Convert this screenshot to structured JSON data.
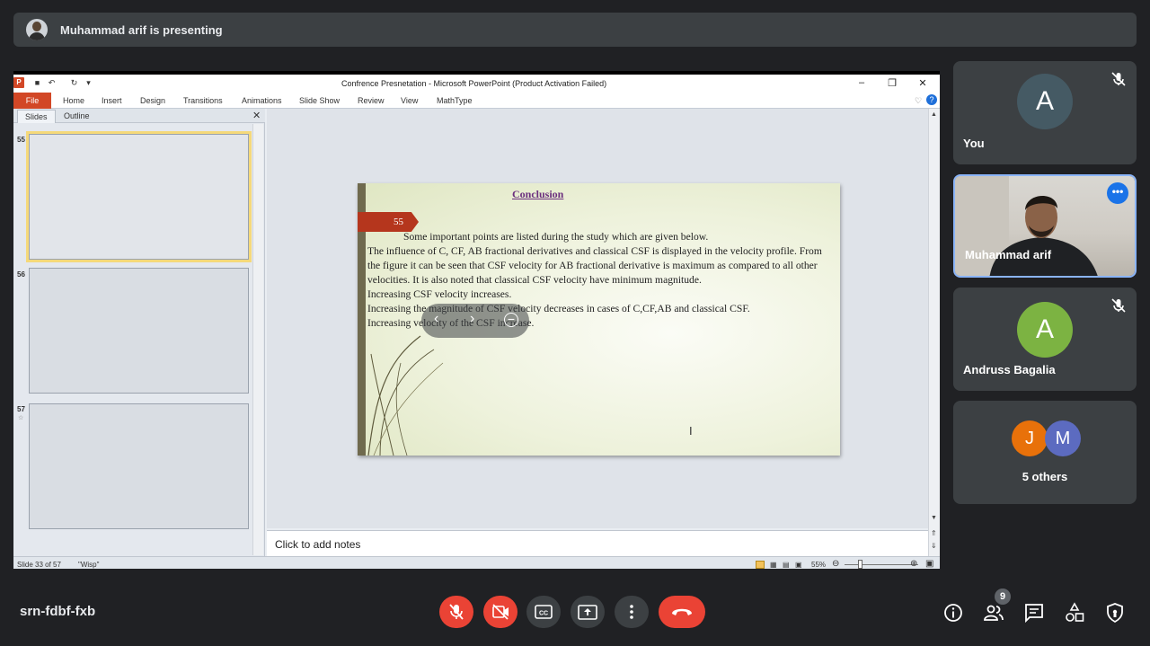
{
  "banner": {
    "text": "Muhammad arif is presenting"
  },
  "ppt": {
    "window_title": "Confrence Presnetation  -  Microsoft PowerPoint (Product Activation Failed)",
    "tabs": [
      "File",
      "Home",
      "Insert",
      "Design",
      "Transitions",
      "Animations",
      "Slide Show",
      "Review",
      "View",
      "MathType"
    ],
    "pane_tabs": [
      "Slides",
      "Outline"
    ],
    "thumbnails": [
      {
        "number": "55",
        "selected": true
      },
      {
        "number": "56",
        "selected": false
      },
      {
        "number": "57",
        "selected": false
      }
    ],
    "slide": {
      "title": "Conclusion",
      "badge": "55",
      "lines": [
        "Some important points are listed  during the study which are given  below.",
        "The influence of C, CF, AB fractional derivatives and classical CSF  is displayed  in the velocity profile. From the figure it can be seen that CSF velocity for AB fractional derivative is maximum as compared to all  other velocities. It is also noted that classical CSF velocity have minimum magnitude.",
        "Increasing  CSF velocity increases.",
        "Increasing the magnitude of CSF velocity decreases in cases of C,CF,AB and classical CSF.",
        "Increasing  velocity of the CSF increase."
      ]
    },
    "notes_placeholder": "Click to add notes",
    "status": {
      "slide_info": "Slide 33 of 57",
      "theme": "\"Wisp\"",
      "zoom": "55%"
    }
  },
  "participants": [
    {
      "name": "You",
      "initial": "A",
      "color": "#455a64",
      "muted": true
    },
    {
      "name": "Muhammad arif",
      "video": true,
      "muted": false
    },
    {
      "name": "Andruss Bagalia",
      "initial": "A",
      "color": "#7cb342",
      "muted": true
    },
    {
      "name": "5 others",
      "initials": [
        "J",
        "M"
      ],
      "colors": [
        "#e8710a",
        "#5c6bc0"
      ]
    }
  ],
  "meeting": {
    "code": "srn-fdbf-fxb",
    "participant_count": "9"
  },
  "colors": {
    "hangup": "#ea4335",
    "control": "#3c4043",
    "accent": "#8ab4f8"
  }
}
